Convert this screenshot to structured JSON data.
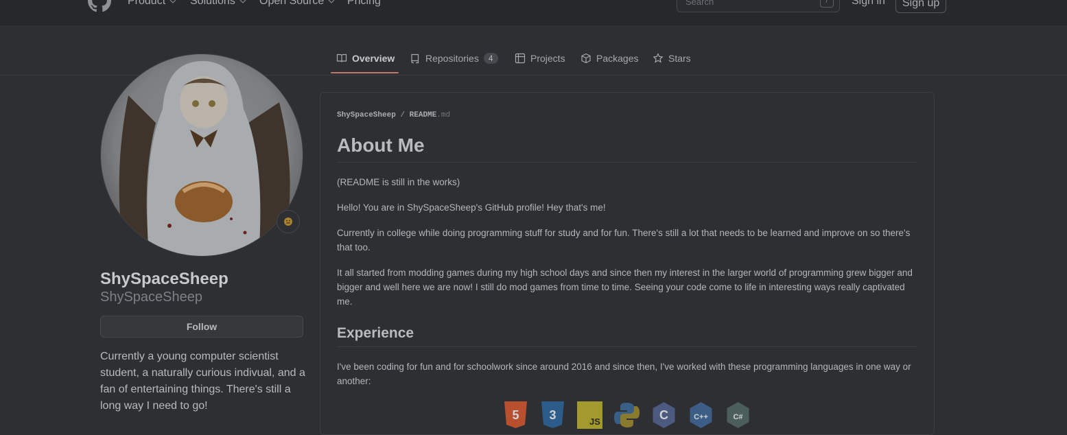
{
  "header": {
    "nav": [
      "Product",
      "Solutions",
      "Open Source",
      "Pricing"
    ],
    "search_placeholder": "Search",
    "search_shortcut": "/",
    "sign_in": "Sign in",
    "sign_up": "Sign up"
  },
  "tabs": [
    {
      "label": "Overview",
      "icon": "book-icon",
      "active": true
    },
    {
      "label": "Repositories",
      "icon": "repo-icon",
      "count": "4"
    },
    {
      "label": "Projects",
      "icon": "project-icon"
    },
    {
      "label": "Packages",
      "icon": "package-icon"
    },
    {
      "label": "Stars",
      "icon": "star-icon"
    }
  ],
  "profile": {
    "full_name": "ShySpaceSheep",
    "login": "ShySpaceSheep",
    "follow_label": "Follow",
    "bio": "Currently a young computer scientist student, a naturally curious indivual, and a fan of entertaining things. There's still a long way I need to go!"
  },
  "readme": {
    "crumb_user": "ShySpaceSheep",
    "crumb_sep": "/",
    "crumb_file": "README",
    "crumb_ext": ".md",
    "title": "About Me",
    "paragraphs": [
      "(README is still in the works)",
      "Hello! You are in ShySpaceSheep's GitHub profile! Hey that's me!",
      "Currently in college while doing programming stuff for study and for fun. There's still a lot that needs to be learned and improve on so there's that too.",
      "It all started from modding games during my high school days and since then my interest in the larger world of programming grew bigger and bigger and well here we are now! I still do mod games from time to time. Seeing your code come to life in interesting ways really captivated me."
    ],
    "experience_title": "Experience",
    "experience_text": "I've been coding for fun and for schoolwork since around 2016 and since then, I've worked with these programming languages in one way or another:",
    "languages": [
      {
        "name": "html5-icon",
        "color": "#b8502f",
        "text": "5"
      },
      {
        "name": "css3-icon",
        "color": "#2b5c8a",
        "text": "3"
      },
      {
        "name": "javascript-icon",
        "color": "#a39a2e",
        "text": "JS"
      },
      {
        "name": "python-icon",
        "color": "#3a5f86",
        "text": ""
      },
      {
        "name": "c-icon",
        "color": "#4d5a80",
        "text": "C"
      },
      {
        "name": "cpp-icon",
        "color": "#3c5d86",
        "text": "C++"
      },
      {
        "name": "csharp-icon",
        "color": "#4b5e5a",
        "text": "C#"
      }
    ]
  }
}
